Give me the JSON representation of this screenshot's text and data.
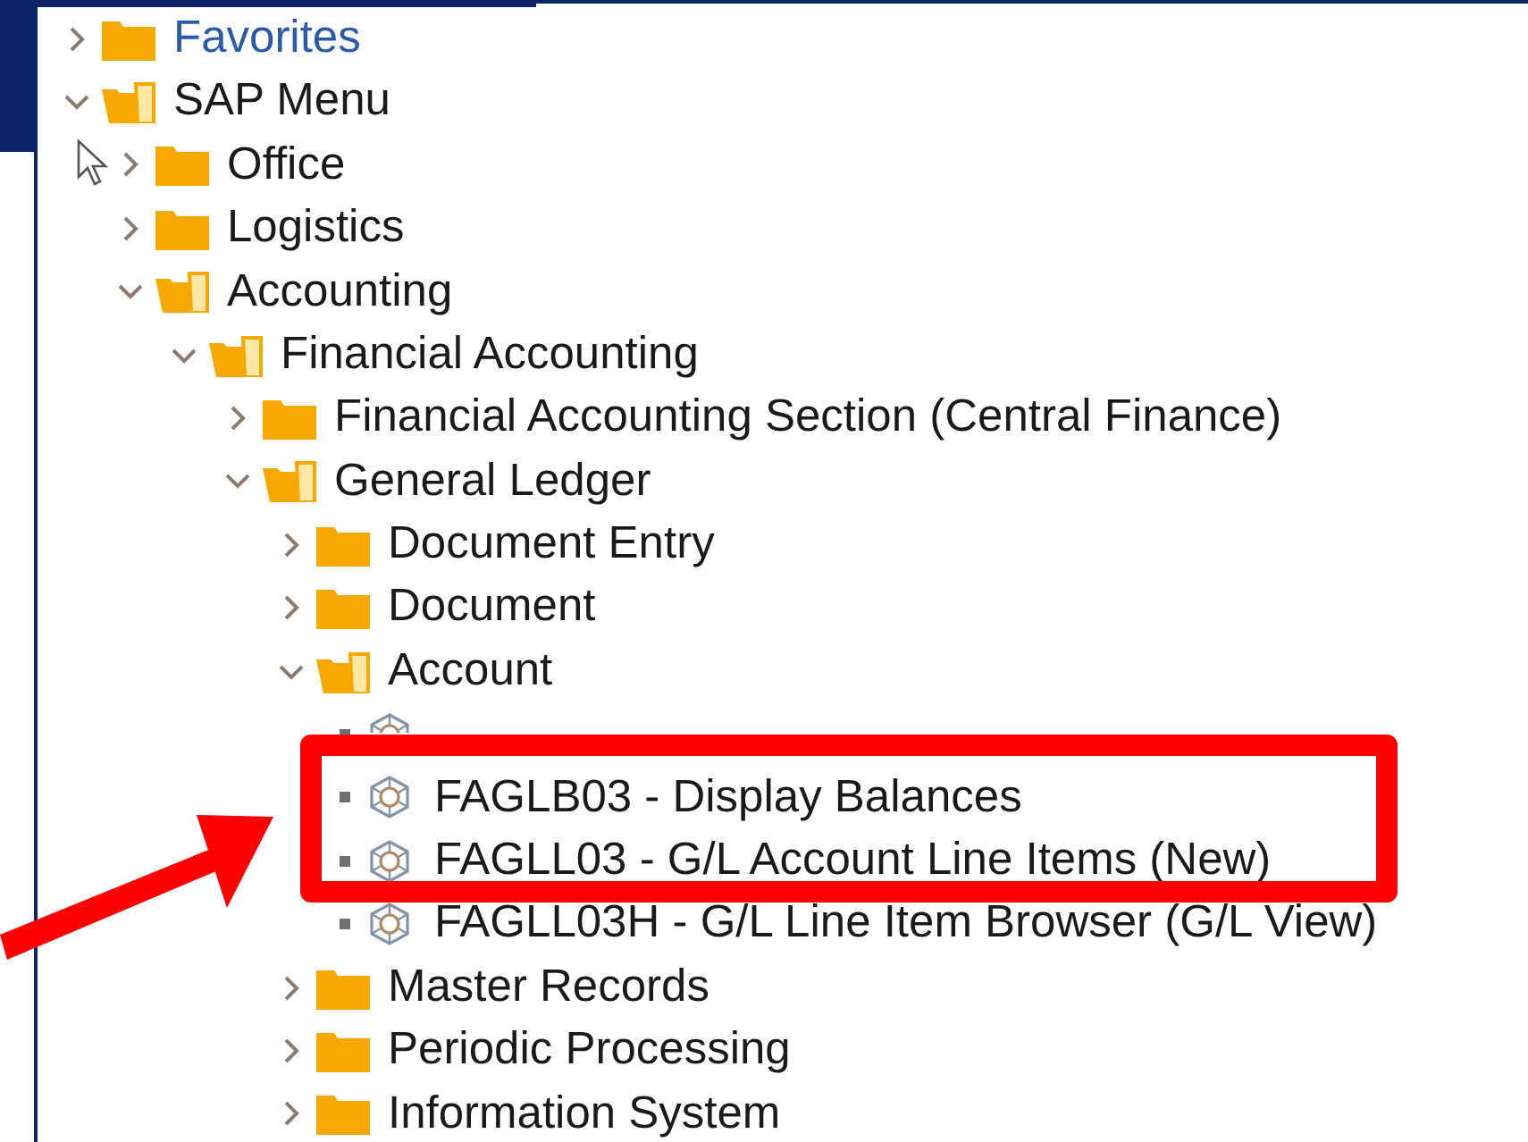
{
  "tree": [
    {
      "label": "Favorites",
      "kind": "favorites",
      "expanded": false
    },
    {
      "label": "SAP Menu",
      "kind": "folder",
      "expanded": true,
      "children": [
        {
          "label": "Office",
          "kind": "folder",
          "expanded": false
        },
        {
          "label": "Logistics",
          "kind": "folder",
          "expanded": false
        },
        {
          "label": "Accounting",
          "kind": "folder",
          "expanded": true,
          "children": [
            {
              "label": "Financial Accounting",
              "kind": "folder",
              "expanded": true,
              "children": [
                {
                  "label": "Financial Accounting Section (Central Finance)",
                  "kind": "folder",
                  "expanded": false
                },
                {
                  "label": "General Ledger",
                  "kind": "folder",
                  "expanded": true,
                  "children": [
                    {
                      "label": "Document Entry",
                      "kind": "folder",
                      "expanded": false
                    },
                    {
                      "label": "Document",
                      "kind": "folder",
                      "expanded": false
                    },
                    {
                      "label": "Account",
                      "kind": "folder",
                      "expanded": true,
                      "children": [
                        {
                          "kind": "transaction"
                        },
                        {
                          "label": "FAGLB03 - Display Balances",
                          "kind": "transaction"
                        },
                        {
                          "label": "FAGLL03 - G/L Account Line Items (New)",
                          "kind": "transaction"
                        },
                        {
                          "label": "FAGLL03H - G/L Line Item Browser (G/L View)",
                          "kind": "transaction"
                        }
                      ]
                    },
                    {
                      "label": "Master Records",
                      "kind": "folder",
                      "expanded": false
                    },
                    {
                      "label": "Periodic Processing",
                      "kind": "folder",
                      "expanded": false
                    },
                    {
                      "label": "Information System",
                      "kind": "folder",
                      "expanded": false
                    }
                  ]
                }
              ]
            }
          ]
        }
      ]
    }
  ]
}
